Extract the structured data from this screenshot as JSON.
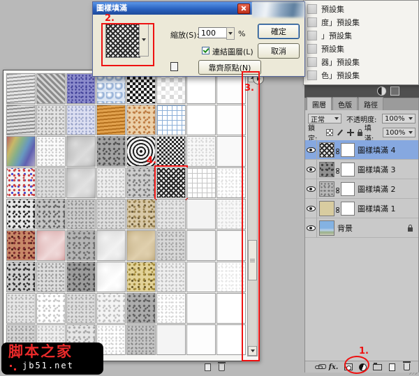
{
  "dialog": {
    "title": "圖樣填滿",
    "scale_label": "縮放(S):",
    "scale_value": "100",
    "percent_label": "%",
    "ok_label": "確定",
    "cancel_label": "取消",
    "link_layer_label": "連結圖層(L)",
    "link_checked": true,
    "snap_origin_label": "靠齊原點(N)",
    "pattern_thumb": {
      "t": "herring",
      "a": "#2a2a2a",
      "b": "#f0f0f0"
    }
  },
  "preset_menu": {
    "items": [
      {
        "label": "預設集"
      },
      {
        "label": "度」預設集"
      },
      {
        "label": "」預設集"
      },
      {
        "label": "預設集"
      },
      {
        "label": "器」預設集"
      },
      {
        "label": "色」預設集"
      }
    ]
  },
  "picker": {
    "selected_index": 29,
    "patterns": [
      {
        "t": "waves",
        "a": "#9a9a9a",
        "b": "#e6e6e6"
      },
      {
        "t": "diag",
        "a": "#8c8c8c",
        "b": "#d4d4d4"
      },
      {
        "t": "noise",
        "a": "#3c3c96",
        "b": "#8c8ccc"
      },
      {
        "t": "dots",
        "a": "#8aa8d2",
        "b": "#dce6f4"
      },
      {
        "t": "checker",
        "a": "#1c1c1c",
        "b": "#ececec"
      },
      {
        "t": "cubes",
        "a": "#d8d8d8",
        "b": "#ffffff"
      },
      {
        "t": "solid",
        "a": "#ffffff",
        "b": "#ffffff"
      },
      {
        "t": "solid",
        "a": "#fdfdfd",
        "b": "#fdfdfd"
      },
      {
        "t": "waves",
        "a": "#8e8e8e",
        "b": "#dedede"
      },
      {
        "t": "noise",
        "a": "#9c9c9c",
        "b": "#e4e4e4"
      },
      {
        "t": "noise",
        "a": "#96a0c8",
        "b": "#dde0f2"
      },
      {
        "t": "waves",
        "a": "#b4701e",
        "b": "#e2a24e"
      },
      {
        "t": "speckle",
        "a": "#c08048",
        "b": "#ecd0a8"
      },
      {
        "t": "grid",
        "a": "#8cb0d8",
        "b": "#ffffff"
      },
      {
        "t": "solid",
        "a": "#ffffff",
        "b": "#ffffff"
      },
      {
        "t": "solid",
        "a": "#fdfdfd",
        "b": "#fdfdfd"
      },
      {
        "t": "rainbow",
        "a": "#b05858",
        "b": "#5858a8"
      },
      {
        "t": "noise",
        "a": "#c4c4c4",
        "b": "#fbfbfb"
      },
      {
        "t": "marble",
        "a": "#8e8e8e",
        "b": "#dcdcdc"
      },
      {
        "t": "speckle",
        "a": "#565656",
        "b": "#a2a2a2"
      },
      {
        "t": "squares",
        "a": "#202020",
        "b": "#f0f0f0"
      },
      {
        "t": "checker",
        "a": "#2a2a2a",
        "b": "#e8e8e8",
        "s": 6
      },
      {
        "t": "noise",
        "a": "#d4d4d4",
        "b": "#f8f8f8"
      },
      {
        "t": "solid",
        "a": "#f9f9f9",
        "b": "#f9f9f9"
      },
      {
        "t": "confetti",
        "a": "#cc4444",
        "b": "#f2f2f2",
        "c": "#4444cc"
      },
      {
        "t": "noise",
        "a": "#a8a8a8",
        "b": "#dedede"
      },
      {
        "t": "marble",
        "a": "#9a9a9a",
        "b": "#e2e2e2"
      },
      {
        "t": "noise",
        "a": "#bcbcbc",
        "b": "#efefef"
      },
      {
        "t": "speckle",
        "a": "#808080",
        "b": "#cccccc"
      },
      {
        "t": "herring",
        "a": "#262626",
        "b": "#f0f0f0"
      },
      {
        "t": "grid",
        "a": "#c6c6c6",
        "b": "#ffffff"
      },
      {
        "t": "noise",
        "a": "#dedede",
        "b": "#ffffff"
      },
      {
        "t": "speckle",
        "a": "#2e2e2e",
        "b": "#e6e6e6"
      },
      {
        "t": "speckle",
        "a": "#6a6a6a",
        "b": "#c4c4c4"
      },
      {
        "t": "noise",
        "a": "#8a8a8a",
        "b": "#cccccc"
      },
      {
        "t": "noise",
        "a": "#a4a4a4",
        "b": "#dedede"
      },
      {
        "t": "confetti",
        "a": "#9a8452",
        "b": "#d8c8a6",
        "c": "#6a5a3a"
      },
      {
        "t": "noise",
        "a": "#b4b4b4",
        "b": "#e6e6e6"
      },
      {
        "t": "solid",
        "a": "#f4f4f4",
        "b": "#f4f4f4"
      },
      {
        "t": "noise",
        "a": "#dedede",
        "b": "#f8f8f8"
      },
      {
        "t": "confetti",
        "a": "#833030",
        "b": "#c88868",
        "c": "#50201a"
      },
      {
        "t": "marble",
        "a": "#c47c7c",
        "b": "#f0dada"
      },
      {
        "t": "speckle",
        "a": "#747474",
        "b": "#b4b4b4"
      },
      {
        "t": "marble",
        "a": "#bcbcbc",
        "b": "#f2f2f2"
      },
      {
        "t": "marble",
        "a": "#ac9462",
        "b": "#e0d0ae"
      },
      {
        "t": "noise",
        "a": "#9e9e9e",
        "b": "#d8d8d8"
      },
      {
        "t": "solid",
        "a": "#f6f6f6",
        "b": "#f6f6f6"
      },
      {
        "t": "solid",
        "a": "#fafafa",
        "b": "#fafafa"
      },
      {
        "t": "speckle",
        "a": "#3c3c3c",
        "b": "#cecece"
      },
      {
        "t": "noise",
        "a": "#949494",
        "b": "#dedede"
      },
      {
        "t": "speckle",
        "a": "#545454",
        "b": "#9c9c9c"
      },
      {
        "t": "marble",
        "a": "#cccccc",
        "b": "#ffffff"
      },
      {
        "t": "confetti",
        "a": "#a48c3c",
        "b": "#e2d298",
        "c": "#6a5a2a"
      },
      {
        "t": "noise",
        "a": "#bcbcbc",
        "b": "#efefef"
      },
      {
        "t": "solid",
        "a": "#f8f8f8",
        "b": "#f8f8f8"
      },
      {
        "t": "noise",
        "a": "#e6e6e6",
        "b": "#ffffff"
      },
      {
        "t": "noise",
        "a": "#acacac",
        "b": "#e6e6e6"
      },
      {
        "t": "speckle",
        "a": "#cccccc",
        "b": "#ffffff"
      },
      {
        "t": "noise",
        "a": "#a4a4a4",
        "b": "#dedede"
      },
      {
        "t": "speckle",
        "a": "#c4c4c4",
        "b": "#f4f4f4"
      },
      {
        "t": "speckle",
        "a": "#646464",
        "b": "#acacac"
      },
      {
        "t": "noise",
        "a": "#d4d4d4",
        "b": "#ffffff"
      },
      {
        "t": "solid",
        "a": "#fbfbfb",
        "b": "#fbfbfb"
      },
      {
        "t": "solid",
        "a": "#ffffff",
        "b": "#ffffff"
      },
      {
        "t": "noise",
        "a": "#949494",
        "b": "#d6d6d6"
      },
      {
        "t": "noise",
        "a": "#bcbcbc",
        "b": "#efefef"
      },
      {
        "t": "speckle",
        "a": "#acacac",
        "b": "#e6e6e6"
      },
      {
        "t": "noise",
        "a": "#cccccc",
        "b": "#ffffff"
      },
      {
        "t": "noise",
        "a": "#848484",
        "b": "#c6c6c6"
      },
      {
        "t": "solid",
        "a": "#f4f4f4",
        "b": "#f4f4f4"
      },
      {
        "t": "solid",
        "a": "#fdfdfd",
        "b": "#fdfdfd"
      },
      {
        "t": "solid",
        "a": "#ffffff",
        "b": "#ffffff"
      }
    ]
  },
  "layers": {
    "tabs": [
      {
        "label": "圖層",
        "active": true
      },
      {
        "label": "色版"
      },
      {
        "label": "路徑"
      }
    ],
    "blend_mode": "正常",
    "opacity_label": "不透明度:",
    "opacity_value": "100%",
    "lock_label": "鎖定:",
    "fill_label": "填滿:",
    "fill_value": "100%",
    "lock_icons": [
      {
        "name": "lock-transparent-icon"
      },
      {
        "name": "lock-paint-icon"
      },
      {
        "name": "lock-move-icon"
      },
      {
        "name": "lock-all-icon"
      }
    ],
    "items": [
      {
        "label": "圖樣填滿 4",
        "selected": true,
        "mask": true,
        "thumb": {
          "t": "herring",
          "a": "#2a2a2a",
          "b": "#e8e8e8"
        }
      },
      {
        "label": "圖樣填滿 3",
        "mask": true,
        "thumb": {
          "t": "speckle",
          "a": "#404040",
          "b": "#909090"
        }
      },
      {
        "label": "圖樣填滿 2",
        "mask": true,
        "thumb": {
          "t": "noise",
          "a": "#707070",
          "b": "#b8b8b8"
        }
      },
      {
        "label": "圖樣填滿 1",
        "mask": true,
        "thumb": {
          "t": "solid",
          "a": "#d8cca0",
          "b": "#d8cca0"
        }
      },
      {
        "label": "背景",
        "locked": true,
        "thumb": {
          "t": "photo",
          "a": "#84b2e2",
          "b": "#c8d8e8"
        }
      }
    ],
    "bottom_icons": [
      {
        "name": "link-layers-icon"
      },
      {
        "name": "layer-style-icon",
        "label": "fx."
      },
      {
        "name": "add-mask-icon"
      },
      {
        "name": "adjustment-layer-icon",
        "annotated": true
      },
      {
        "name": "group-icon"
      },
      {
        "name": "new-layer-icon"
      },
      {
        "name": "delete-layer-icon"
      }
    ]
  },
  "annotations": {
    "color": "#ee1111",
    "step1": "1.",
    "step2": "2.",
    "step3": "3.",
    "step4": "4."
  },
  "watermark": {
    "title": "脚本之家",
    "domain": "jb51.net"
  }
}
